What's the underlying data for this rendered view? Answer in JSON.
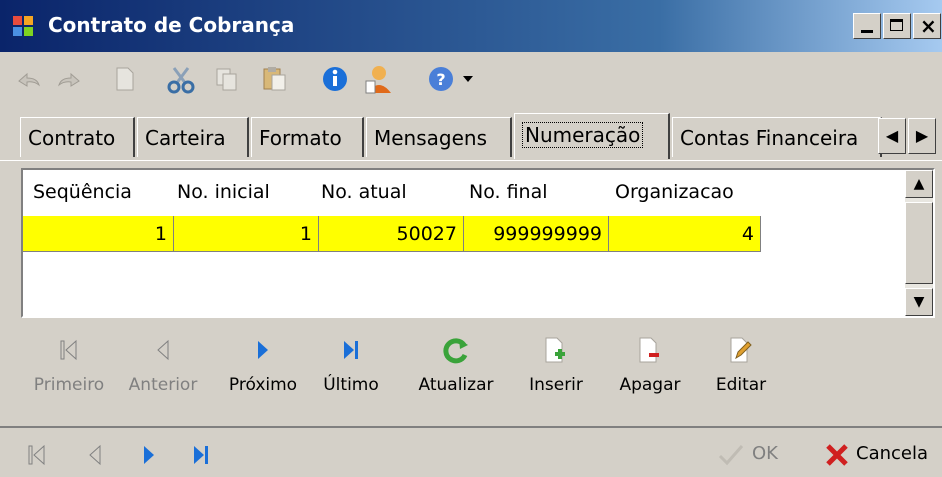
{
  "window": {
    "title": "Contrato de Cobrança"
  },
  "toolbar": {
    "icons": [
      "undo-icon",
      "redo-icon",
      "new-document-icon",
      "cut-icon",
      "copy-icon",
      "paste-icon",
      "info-icon",
      "user-icon",
      "help-icon",
      "dropdown-arrow-icon"
    ]
  },
  "tabs": [
    {
      "label": "Contrato",
      "active": false
    },
    {
      "label": "Carteira",
      "active": false
    },
    {
      "label": "Formato",
      "active": false
    },
    {
      "label": "Mensagens",
      "active": false
    },
    {
      "label": "Numeração",
      "active": true
    },
    {
      "label": "Contas Financeira",
      "active": false
    }
  ],
  "grid": {
    "columns": [
      "Seqüência",
      "No. inicial",
      "No. atual",
      "No. final",
      "Organizacao"
    ],
    "rows": [
      [
        "1",
        "1",
        "50027",
        "999999999",
        "4"
      ]
    ]
  },
  "nav": {
    "first": "Primeiro",
    "prev": "Anterior",
    "next": "Próximo",
    "last": "Último",
    "refresh": "Atualizar",
    "insert": "Inserir",
    "delete": "Apagar",
    "edit": "Editar"
  },
  "footer": {
    "ok": "OK",
    "cancel": "Cancela"
  },
  "colors": {
    "titlebar": "#0a246a",
    "row_highlight": "#ffff00",
    "nav_active": "#1a6fd8",
    "refresh_green": "#3aa33a",
    "cancel_red": "#d02020"
  }
}
